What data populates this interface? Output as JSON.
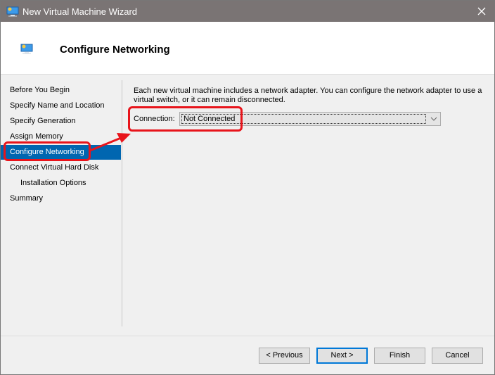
{
  "window": {
    "title": "New Virtual Machine Wizard",
    "title_icon": "monitor-icon",
    "close_icon": "close-icon"
  },
  "header": {
    "title": "Configure Networking",
    "icon": "monitor-icon"
  },
  "sidebar": {
    "items": [
      {
        "label": "Before You Begin",
        "active": false,
        "sub": false
      },
      {
        "label": "Specify Name and Location",
        "active": false,
        "sub": false
      },
      {
        "label": "Specify Generation",
        "active": false,
        "sub": false
      },
      {
        "label": "Assign Memory",
        "active": false,
        "sub": false
      },
      {
        "label": "Configure Networking",
        "active": true,
        "sub": false
      },
      {
        "label": "Connect Virtual Hard Disk",
        "active": false,
        "sub": false
      },
      {
        "label": "Installation Options",
        "active": false,
        "sub": true
      },
      {
        "label": "Summary",
        "active": false,
        "sub": false
      }
    ]
  },
  "main": {
    "description": "Each new virtual machine includes a network adapter. You can configure the network adapter to use a virtual switch, or it can remain disconnected.",
    "connection_label": "Connection:",
    "connection_value": "Not Connected"
  },
  "footer": {
    "previous_label": "< Previous",
    "next_label": "Next >",
    "finish_label": "Finish",
    "cancel_label": "Cancel"
  },
  "annotation": {
    "color": "#e8141b"
  },
  "colors": {
    "titlebar": "#7a7474",
    "selected": "#0066b0",
    "default_button_border": "#0078d7"
  }
}
